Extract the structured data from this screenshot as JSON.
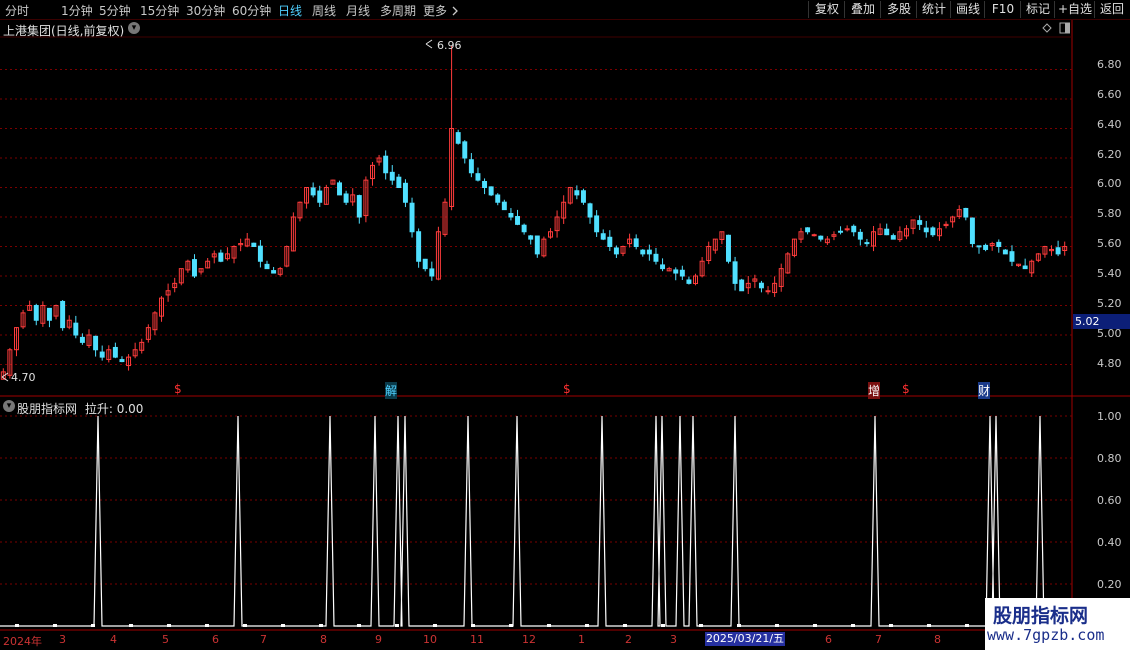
{
  "toolbar": {
    "periods": [
      "分时",
      "1分钟",
      "5分钟",
      "15分钟",
      "30分钟",
      "60分钟",
      "日线",
      "周线",
      "月线",
      "多周期",
      "更多"
    ],
    "active_period": "日线",
    "more_icon": "chevron-right-icon",
    "right_buttons": [
      "复权",
      "叠加",
      "多股",
      "统计",
      "画线",
      "F10",
      "标记",
      "+自选",
      "返回"
    ]
  },
  "main_chart": {
    "title": "上港集团(日线,前复权)",
    "y_ticks": [
      "6.80",
      "6.60",
      "6.40",
      "6.20",
      "6.00",
      "5.80",
      "5.60",
      "5.40",
      "5.20",
      "5.00",
      "4.80"
    ],
    "high_label": "6.96",
    "low_label": "4.70",
    "current_price": "5.02",
    "events": [
      {
        "label": "$",
        "color": "#ff3030"
      },
      {
        "label": "解",
        "color": "#4fd0ff"
      },
      {
        "label": "$",
        "color": "#ff3030"
      },
      {
        "label": "增",
        "color": "#ff6060"
      },
      {
        "label": "$",
        "color": "#ff3030"
      },
      {
        "label": "财",
        "color": "#4fd0ff"
      }
    ]
  },
  "indicator": {
    "title": "股朋指标网",
    "value_text": "拉升: 0.00",
    "y_ticks": [
      "1.00",
      "0.80",
      "0.60",
      "0.40",
      "0.20"
    ]
  },
  "x_axis": {
    "labels": [
      "2024年",
      "3",
      "4",
      "5",
      "6",
      "7",
      "8",
      "9",
      "10",
      "11",
      "12",
      "1",
      "2",
      "3",
      "6",
      "7",
      "8"
    ],
    "cursor_date": "2025/03/21/五"
  },
  "watermark": {
    "line1": "股朋指标网",
    "line2": "www.7gpzb.com"
  },
  "colors": {
    "up": "#ff3c3c",
    "down": "#50e0ff",
    "grid": "#7a0000",
    "background": "#000000"
  },
  "chart_data": {
    "type": "candlestick",
    "title": "",
    "ylim": [
      4.6,
      7.0
    ],
    "close": [
      4.75,
      4.9,
      5.05,
      5.15,
      5.2,
      5.1,
      5.2,
      5.1,
      5.2,
      5.05,
      5.1,
      5.0,
      4.95,
      5.0,
      4.9,
      4.85,
      4.9,
      4.85,
      4.82,
      4.85,
      4.9,
      4.95,
      5.05,
      5.15,
      5.25,
      5.3,
      5.35,
      5.45,
      5.5,
      5.4,
      5.45,
      5.5,
      5.55,
      5.5,
      5.55,
      5.6,
      5.62,
      5.65,
      5.6,
      5.5,
      5.45,
      5.42,
      5.45,
      5.6,
      5.8,
      5.9,
      6.0,
      5.95,
      5.9,
      6.0,
      6.05,
      5.95,
      5.9,
      5.95,
      5.8,
      6.05,
      6.15,
      6.2,
      6.1,
      6.05,
      6.0,
      5.9,
      5.7,
      5.5,
      5.45,
      5.4,
      5.7,
      5.9,
      6.4,
      6.3,
      6.2,
      6.1,
      6.05,
      6.0,
      5.95,
      5.9,
      5.85,
      5.8,
      5.75,
      5.7,
      5.65,
      5.55,
      5.65,
      5.7,
      5.8,
      5.9,
      6.0,
      5.95,
      5.9,
      5.8,
      5.7,
      5.65,
      5.6,
      5.55,
      5.6,
      5.65,
      5.6,
      5.55,
      5.55,
      5.5,
      5.45,
      5.45,
      5.42,
      5.4,
      5.35,
      5.4,
      5.5,
      5.6,
      5.65,
      5.7,
      5.5,
      5.35,
      5.3,
      5.35,
      5.38,
      5.32,
      5.3,
      5.35,
      5.45,
      5.55,
      5.65,
      5.7,
      5.7,
      5.68,
      5.65,
      5.65,
      5.68,
      5.7,
      5.72,
      5.7,
      5.65,
      5.62,
      5.7,
      5.72,
      5.68,
      5.65,
      5.7,
      5.72,
      5.78,
      5.75,
      5.7,
      5.68,
      5.72,
      5.75,
      5.8,
      5.85,
      5.8,
      5.62,
      5.6,
      5.58,
      5.62,
      5.6,
      5.55,
      5.5,
      5.48,
      5.45,
      5.5,
      5.55,
      5.6,
      5.58,
      5.55,
      5.6
    ]
  }
}
